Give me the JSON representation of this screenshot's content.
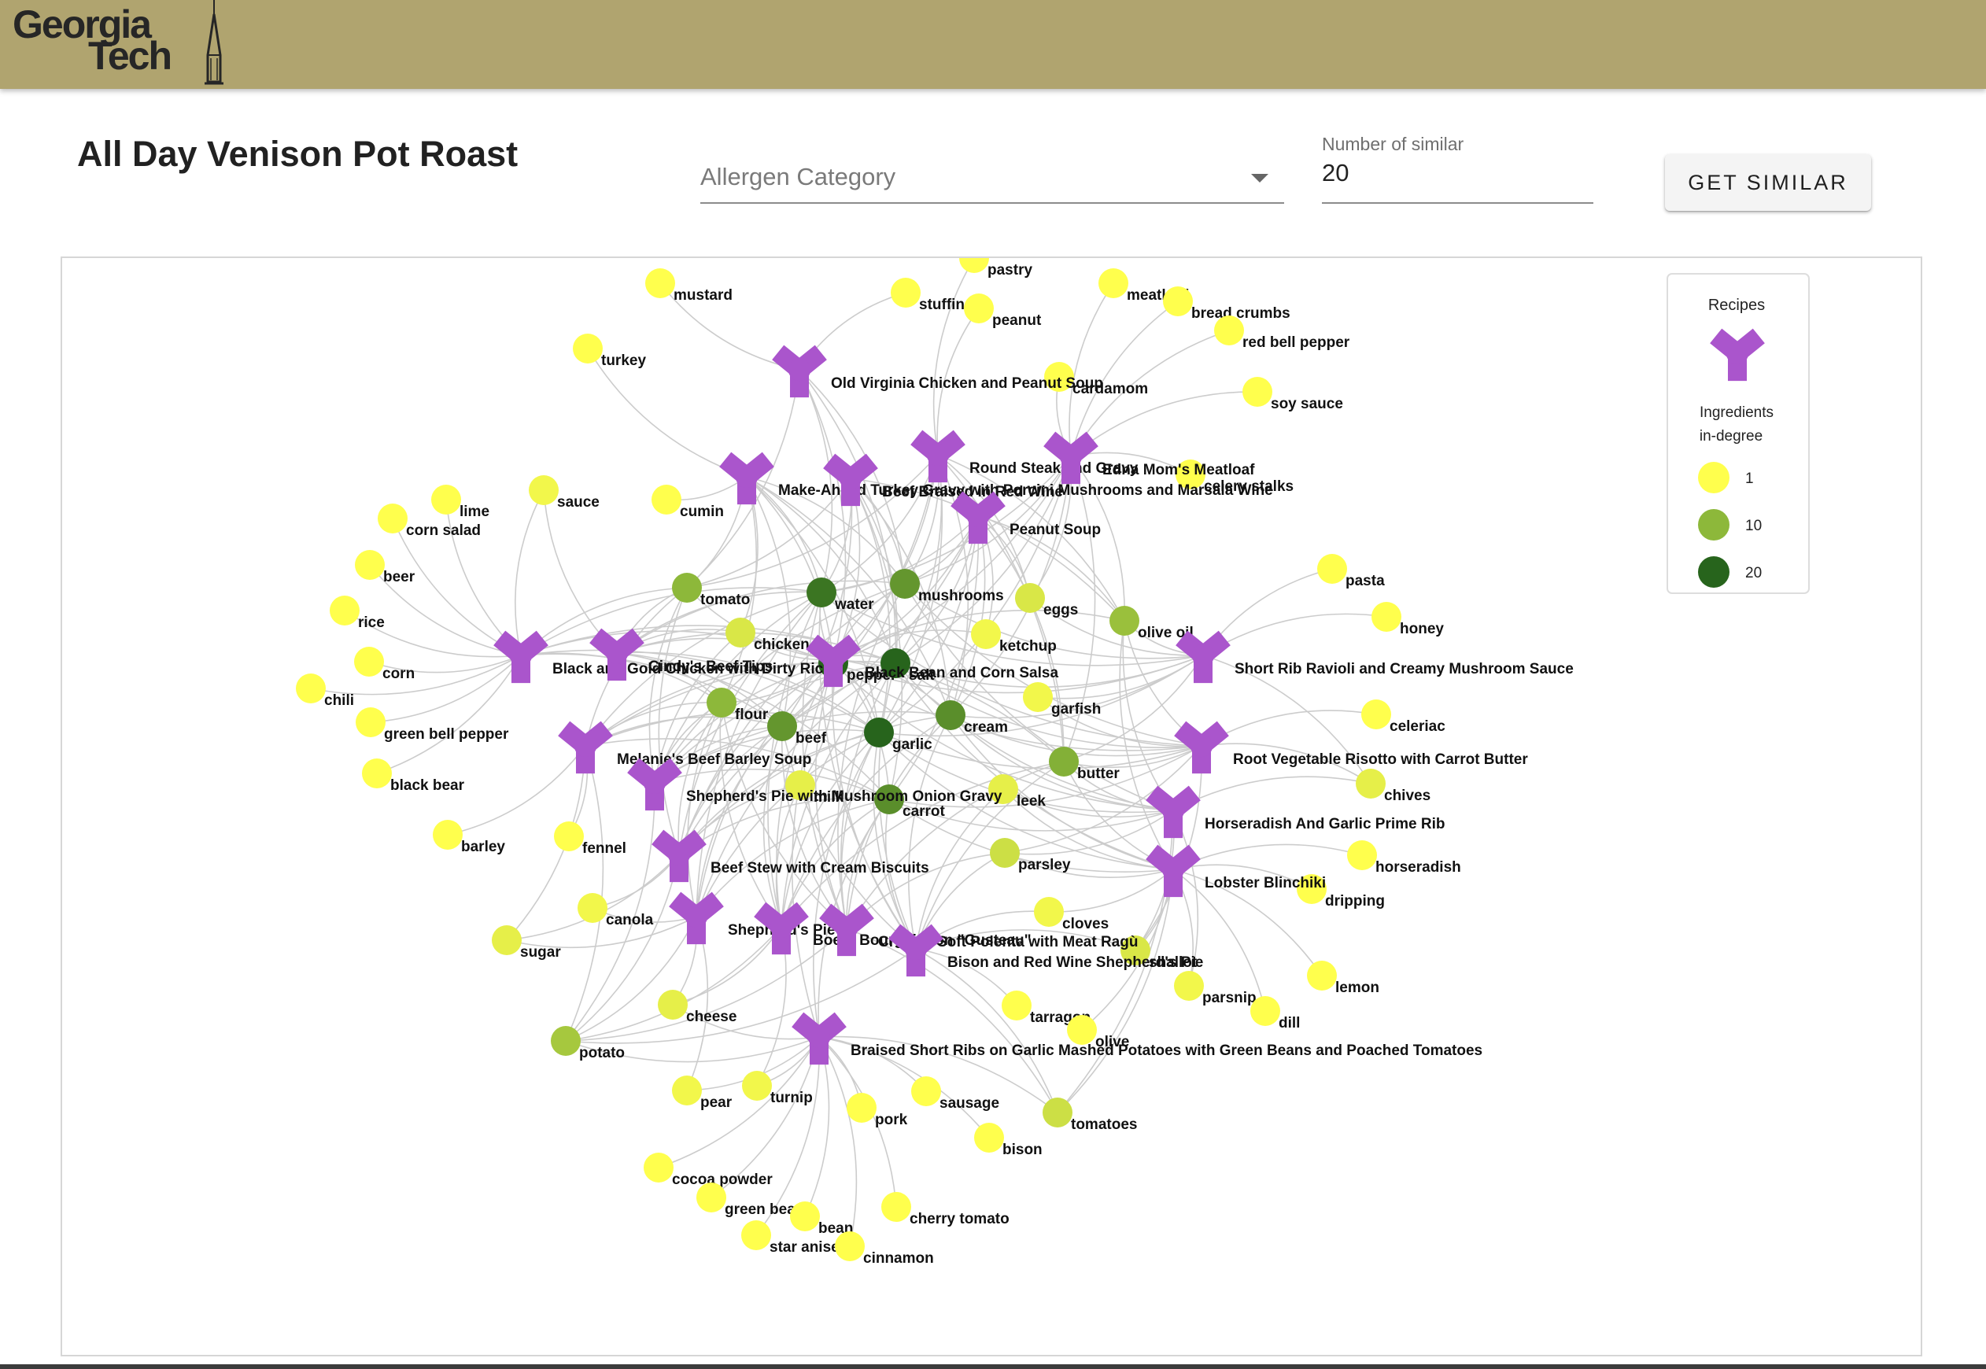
{
  "header": {
    "logo_line1": "Georgia",
    "logo_line2": "Tech",
    "bar_color": "#b0a46f"
  },
  "page_title": "All Day Venison Pot Roast",
  "allergen_select": {
    "label": "Allergen Category"
  },
  "similar_count": {
    "label": "Number of similar",
    "value": "20"
  },
  "button_label": "GET SIMILAR",
  "legend": {
    "recipes_title": "Recipes",
    "ingredients_title_line1": "Ingredients",
    "ingredients_title_line2": "in-degree",
    "items": [
      {
        "label": "1",
        "color": "#ffff4d"
      },
      {
        "label": "10",
        "color": "#8db83a"
      },
      {
        "label": "20",
        "color": "#27641c"
      }
    ]
  },
  "colors": {
    "recipe": "#aa55cc",
    "edge": "#cccccc",
    "ingredient_low": "#ffff4d",
    "ingredient_mid": "#8db83a",
    "ingredient_high": "#27641c"
  },
  "graph": {
    "recipes": [
      {
        "label": "Old Virginia Chicken and Peanut Soup"
      },
      {
        "label": "Make-Ahead Turkey Gravy with Porcini Mushrooms and Marsala Wine"
      },
      {
        "label": "Beef Braised in Red Wine"
      },
      {
        "label": "Round Steak and Gravy"
      },
      {
        "label": "Edna Mom's Meatloaf"
      },
      {
        "label": "Peanut Soup"
      },
      {
        "label": "Black and Gold Chicken with Dirty Rice"
      },
      {
        "label": "Cindy's Beef Tips"
      },
      {
        "label": "Black Bean and Corn Salsa"
      },
      {
        "label": "Short Rib Ravioli and Creamy Mushroom Sauce"
      },
      {
        "label": "Melanie's Beef Barley Soup"
      },
      {
        "label": "Root Vegetable Risotto with Carrot Butter"
      },
      {
        "label": "Shepherd's Pie with Mushroom Onion Gravy"
      },
      {
        "label": "Horseradish And Garlic Prime Rib"
      },
      {
        "label": "Beef Stew with Cream Biscuits"
      },
      {
        "label": "Lobster Blinchiki"
      },
      {
        "label": "Shepherd's Pie"
      },
      {
        "label": "Boeuf Bourguignon \"Gusteau\""
      },
      {
        "label": "Creamy Soft Polenta with Meat Ragù"
      },
      {
        "label": "Bison and Red Wine Shepherd's Pie"
      },
      {
        "label": "Braised Short Ribs on Garlic Mashed Potatoes with Green Beans and Poached Tomatoes"
      }
    ],
    "ingredients": [
      {
        "label": "pastry",
        "degree": 1
      },
      {
        "label": "mustard",
        "degree": 1
      },
      {
        "label": "stuffing",
        "degree": 1
      },
      {
        "label": "peanut",
        "degree": 1
      },
      {
        "label": "meatloaf",
        "degree": 1
      },
      {
        "label": "bread crumbs",
        "degree": 1
      },
      {
        "label": "red bell pepper",
        "degree": 1
      },
      {
        "label": "turkey",
        "degree": 1
      },
      {
        "label": "cardamom",
        "degree": 1
      },
      {
        "label": "soy sauce",
        "degree": 1
      },
      {
        "label": "celery stalks",
        "degree": 1
      },
      {
        "label": "lime",
        "degree": 1
      },
      {
        "label": "sauce",
        "degree": 2
      },
      {
        "label": "cumin",
        "degree": 1
      },
      {
        "label": "corn salad",
        "degree": 1
      },
      {
        "label": "beer",
        "degree": 1
      },
      {
        "label": "rice",
        "degree": 1
      },
      {
        "label": "corn",
        "degree": 1
      },
      {
        "label": "chili",
        "degree": 1
      },
      {
        "label": "green bell pepper",
        "degree": 1
      },
      {
        "label": "black bear",
        "degree": 1
      },
      {
        "label": "barley",
        "degree": 1
      },
      {
        "label": "pasta",
        "degree": 1
      },
      {
        "label": "honey",
        "degree": 1
      },
      {
        "label": "tomato",
        "degree": 10
      },
      {
        "label": "water",
        "degree": 18
      },
      {
        "label": "mushrooms",
        "degree": 14
      },
      {
        "label": "eggs",
        "degree": 4
      },
      {
        "label": "olive oil",
        "degree": 9
      },
      {
        "label": "chicken",
        "degree": 4
      },
      {
        "label": "ketchup",
        "degree": 2
      },
      {
        "label": "pepper",
        "degree": 20
      },
      {
        "label": "salt",
        "degree": 20
      },
      {
        "label": "flour",
        "degree": 10
      },
      {
        "label": "beef",
        "degree": 14
      },
      {
        "label": "garlic",
        "degree": 20
      },
      {
        "label": "cream",
        "degree": 15
      },
      {
        "label": "garfish",
        "degree": 2
      },
      {
        "label": "celeriac",
        "degree": 1
      },
      {
        "label": "butter",
        "degree": 11
      },
      {
        "label": "chives",
        "degree": 3
      },
      {
        "label": "milk",
        "degree": 3
      },
      {
        "label": "carrot",
        "degree": 15
      },
      {
        "label": "leek",
        "degree": 3
      },
      {
        "label": "fennel",
        "degree": 1
      },
      {
        "label": "parsley",
        "degree": 5
      },
      {
        "label": "horseradish",
        "degree": 1
      },
      {
        "label": "dripping",
        "degree": 1
      },
      {
        "label": "canola",
        "degree": 2
      },
      {
        "label": "cloves",
        "degree": 2
      },
      {
        "label": "sugar",
        "degree": 3
      },
      {
        "label": "shallot",
        "degree": 4
      },
      {
        "label": "lemon",
        "degree": 1
      },
      {
        "label": "parsnip",
        "degree": 2
      },
      {
        "label": "cheese",
        "degree": 3
      },
      {
        "label": "tarragon",
        "degree": 1
      },
      {
        "label": "dill",
        "degree": 1
      },
      {
        "label": "olive",
        "degree": 1
      },
      {
        "label": "potato",
        "degree": 8
      },
      {
        "label": "pear",
        "degree": 2
      },
      {
        "label": "turnip",
        "degree": 2
      },
      {
        "label": "sausage",
        "degree": 1
      },
      {
        "label": "pork",
        "degree": 1
      },
      {
        "label": "tomatoes",
        "degree": 5
      },
      {
        "label": "bison",
        "degree": 1
      },
      {
        "label": "cocoa powder",
        "degree": 1
      },
      {
        "label": "green bean",
        "degree": 1
      },
      {
        "label": "bean",
        "degree": 1
      },
      {
        "label": "cherry tomato",
        "degree": 1
      },
      {
        "label": "star anise",
        "degree": 1
      },
      {
        "label": "cinnamon",
        "degree": 1
      }
    ]
  }
}
